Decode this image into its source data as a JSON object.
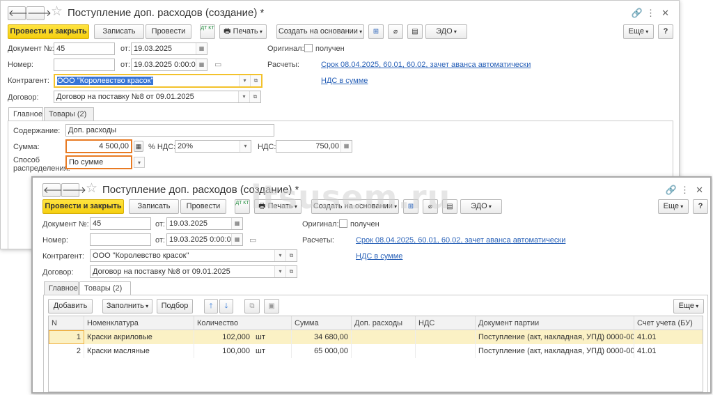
{
  "back": {
    "title": "Поступление доп. расходов (создание) *",
    "toolbar": {
      "post_close": "Провести и закрыть",
      "write": "Записать",
      "post": "Провести",
      "dtkt": "ДТ КТ",
      "print": "Печать",
      "create_based": "Создать на основании",
      "edo": "ЭДО",
      "more": "Еще",
      "help": "?"
    },
    "doc_label": "Документ №:",
    "doc_value": "45",
    "from_label": "от:",
    "date_value": "19.03.2025",
    "num_label": "Номер:",
    "num_value": "",
    "datetime_value": "19.03.2025  0:00:00",
    "original_label": "Оригинал:",
    "received_label": "получен",
    "settlements_label": "Расчеты:",
    "settlements_link": "Срок 08.04.2025, 60.01, 60.02, зачет аванса автоматически",
    "vat_link": "НДС в сумме",
    "counterparty_label": "Контрагент:",
    "counterparty_value": "ООО \"Королевство красок\"",
    "contract_label": "Договор:",
    "contract_value": "Договор на поставку №8 от 09.01.2025",
    "tabs": [
      "Главное",
      "Товары (2)"
    ],
    "content_label": "Содержание:",
    "content_value": "Доп. расходы",
    "sum_label": "Сумма:",
    "sum_value": "4 500,00",
    "vat_rate_label": "% НДС:",
    "vat_rate_value": "20%",
    "vat_label": "НДС:",
    "vat_value": "750,00",
    "distribution_label_1": "Способ",
    "distribution_label_2": "распределения:",
    "distribution_value": "По сумме"
  },
  "front": {
    "title": "Поступление доп. расходов (создание) *",
    "toolbar": {
      "post_close": "Провести и закрыть",
      "write": "Записать",
      "post": "Провести",
      "dtkt": "ДТ КТ",
      "print": "Печать",
      "create_based": "Создать на основании",
      "edo": "ЭДО",
      "more": "Еще",
      "help": "?"
    },
    "doc_label": "Документ №:",
    "doc_value": "45",
    "from_label": "от:",
    "date_value": "19.03.2025",
    "num_label": "Номер:",
    "num_value": "",
    "datetime_value": "19.03.2025  0:00:00",
    "original_label": "Оригинал:",
    "received_label": "получен",
    "settlements_label": "Расчеты:",
    "settlements_link": "Срок 08.04.2025, 60.01, 60.02, зачет аванса автоматически",
    "vat_link": "НДС в сумме",
    "counterparty_label": "Контрагент:",
    "counterparty_value": "ООО \"Королевство красок\"",
    "contract_label": "Договор:",
    "contract_value": "Договор на поставку №8 от 09.01.2025",
    "tabs": [
      "Главное",
      "Товары (2)"
    ],
    "grid_toolbar": {
      "add": "Добавить",
      "fill": "Заполнить",
      "select": "Подбор",
      "more": "Еще"
    },
    "columns": [
      "N",
      "Номенклатура",
      "Количество",
      "Сумма",
      "Доп. расходы",
      "НДС",
      "Документ партии",
      "Счет учета (БУ)"
    ],
    "rows": [
      {
        "n": "1",
        "item": "Краски акриловые",
        "qty": "102,000",
        "unit": "шт",
        "sum": "34 680,00",
        "extra": "",
        "vat": "",
        "batch": "Поступление (акт, накладная, УПД) 0000-000...",
        "account": "41.01"
      },
      {
        "n": "2",
        "item": "Краски масляные",
        "qty": "100,000",
        "unit": "шт",
        "sum": "65 000,00",
        "extra": "",
        "vat": "",
        "batch": "Поступление (акт, накладная, УПД) 0000-000...",
        "account": "41.01"
      }
    ]
  },
  "watermark": "itsusem.ru",
  "colors": {
    "primary_button": "#f5d315",
    "link": "#2a62b8",
    "highlight_border": "#e87a22",
    "selected_row": "#fbf1c5",
    "selection": "#3875d7"
  }
}
